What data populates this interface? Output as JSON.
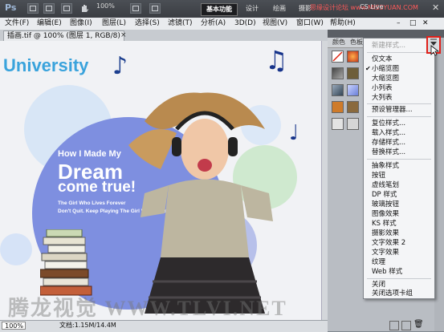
{
  "app": {
    "logo": "Ps",
    "zoom": "100%",
    "cs_live": "CS Live"
  },
  "workspaces": [
    "基本功能",
    "设计",
    "绘画",
    "摄影"
  ],
  "top_watermark": "思缘设计论坛 www.MISSYUAN.COM",
  "menu": [
    "文件(F)",
    "编辑(E)",
    "图像(I)",
    "图层(L)",
    "选择(S)",
    "滤镜(T)",
    "分析(A)",
    "3D(D)",
    "视图(V)",
    "窗口(W)",
    "帮助(H)"
  ],
  "document": {
    "tab": "插画.tif @ 100% (图层 1, RGB/8)",
    "close": "×"
  },
  "status": {
    "zoom": "100%",
    "info": "文档:1.15M/14.4M"
  },
  "canvas_text": {
    "university": "University",
    "how": "How I Made My",
    "dream": "Dream",
    "come": "come true!",
    "line1": "The Girl Who Lives Forever",
    "line2": "Don't Quit. Keep Playing The Girl Who Lives",
    "watermark": "腾龙视觉 WWW.TLVI.NET"
  },
  "panel": {
    "tabs": [
      "颜色",
      "色板"
    ]
  },
  "dropdown": {
    "items": [
      {
        "label": "新建样式...",
        "disabled": true
      },
      {
        "label": "仅文本"
      },
      {
        "label": "小缩览图",
        "checked": true
      },
      {
        "label": "大缩览图"
      },
      {
        "label": "小列表"
      },
      {
        "label": "大列表"
      },
      {
        "label": "预设管理器..."
      },
      {
        "label": "复位样式..."
      },
      {
        "label": "载入样式..."
      },
      {
        "label": "存储样式..."
      },
      {
        "label": "替换样式..."
      },
      {
        "label": "抽象样式"
      },
      {
        "label": "按钮"
      },
      {
        "label": "虚线笔划"
      },
      {
        "label": "DP 样式"
      },
      {
        "label": "玻璃按钮"
      },
      {
        "label": "图像效果"
      },
      {
        "label": "KS 样式"
      },
      {
        "label": "摄影效果"
      },
      {
        "label": "文字效果 2"
      },
      {
        "label": "文字效果"
      },
      {
        "label": "纹理"
      },
      {
        "label": "Web 样式"
      },
      {
        "label": "关闭"
      },
      {
        "label": "关闭选项卡组"
      }
    ],
    "check": "✔"
  },
  "colors": {
    "accent": "#e0201a",
    "brand": "#3aa3dc"
  }
}
